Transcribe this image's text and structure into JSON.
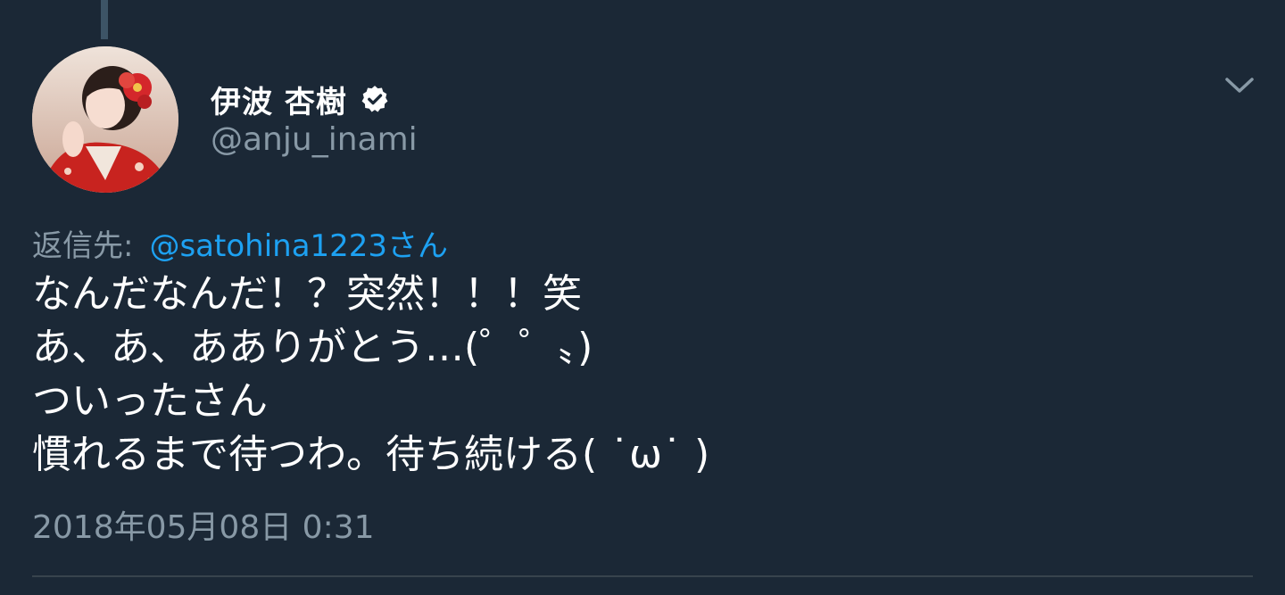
{
  "tweet": {
    "display_name": "伊波 杏樹",
    "handle": "@anju_inami",
    "reply_label": "返信先:",
    "reply_mention": "@satohina1223さん",
    "lines": [
      "なんだなんだ！？突然！！！笑",
      "あ、あ、あありがとう…(゜゜〟)",
      "ついったさん",
      "慣れるまで待つわ。待ち続ける(  ˙ω˙    )"
    ],
    "timestamp": "2018年05月08日  0:31"
  },
  "icons": {
    "verified": "verified-badge-icon",
    "menu": "chevron-down-icon"
  },
  "colors": {
    "background": "#1b2836",
    "secondary_text": "#8899a6",
    "link": "#1da1f2",
    "divider": "#38444d"
  }
}
